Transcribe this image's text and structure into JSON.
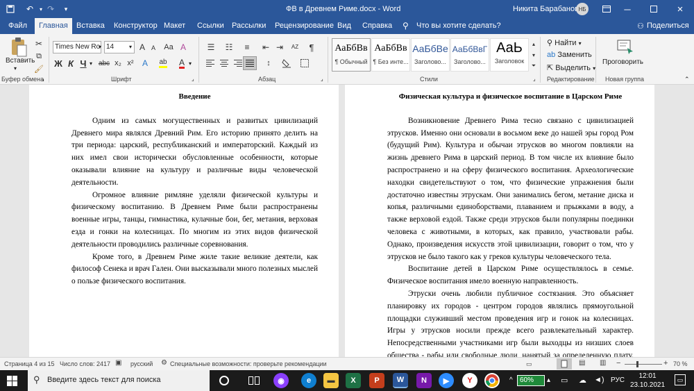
{
  "titlebar": {
    "doc_title": "ФВ в Древнем Риме.docx  -  Word",
    "user": "Никита Барабанов",
    "initials": "НБ"
  },
  "tabs": [
    "Файл",
    "Главная",
    "Вставка",
    "Конструктор",
    "Макет",
    "Ссылки",
    "Рассылки",
    "Рецензирование",
    "Вид",
    "Справка"
  ],
  "tell_me": "Что вы хотите сделать?",
  "share": "Поделиться",
  "ribbon": {
    "clipboard": {
      "paste": "Вставить",
      "label": "Буфер обмена"
    },
    "font": {
      "name": "Times New Ro",
      "size": "14",
      "label": "Шрифт",
      "bold": "Ж",
      "italic": "К",
      "underline": "Ч",
      "strike": "abc",
      "sub": "x₂",
      "sup": "x²",
      "grow": "A",
      "shrink": "A",
      "case": "Aa",
      "clear": "A",
      "highlight": "ab",
      "color": "A",
      "colors": {
        "highlight": "#ffff00",
        "font": "#e02020"
      }
    },
    "paragraph": {
      "label": "Абзац",
      "pilcrow": "¶",
      "sort": "AZ"
    },
    "styles": {
      "label": "Стили",
      "items": [
        {
          "preview": "АаБбВв",
          "name": "¶ Обычный"
        },
        {
          "preview": "АаБбВв",
          "name": "¶ Без инте..."
        },
        {
          "preview": "АаБбВе",
          "name": "Заголово..."
        },
        {
          "preview": "АаБбВвГ",
          "name": "Заголово..."
        },
        {
          "preview": "АаЬ",
          "name": "Заголовок"
        }
      ]
    },
    "editing": {
      "find": "Найти",
      "replace": "Заменить",
      "select": "Выделить",
      "label": "Редактирование"
    },
    "new_group": {
      "button": "Проговорить",
      "label": "Новая группа"
    }
  },
  "page1": {
    "heading": "Введение",
    "paragraphs": [
      "Одним из самых могущественных и развитых цивилизаций Древнего мира являлся Древний Рим. Его историю принято делить на три периода: царский, республиканский и императорский. Каждый из них имел свои историчeски обусловленные особенности, которые оказывали влияние на культуру и различные виды человеческой деятельности.",
      "Огромное влияние римляне уделяли физической культуры и физическому воспитанию. В Древнем Риме были распространены военные игры, танцы, гимнастика, кулачные бои, бег, метания, верховая езда и гонки на колесницах. По многим из этих видов физической деятельности проводились различные соревнования.",
      "Кроме того, в Древнем Риме жиле такие великие деятели, как философ Сенека и врач Гален. Они высказывали много полезных мыслей о пользе физического воспитания."
    ]
  },
  "page2": {
    "heading": "Физическая культура и физическое воспитание в Царском Риме",
    "paragraphs": [
      "Возникновение Древнего Рима тесно связано с цивилизацией этрусков. Именно они основали в восьмом веке до нашей эры город Ром (будущий Рим). Культура и обычаи этрусков во многом повлияли на жизнь древнего Рима в царский период. В том числе их влияние было распространено и на сферу физического воспитания. Археологические находки свидетельствуют о том, что физические упражнения были достаточно известны этрускам. Они занимались бегом, метание диска и копья, различными единоборствами, плаванием и прыжками в воду, а также верховой ездой. Также среди этрусков были популярны поединки человека с животными, в которых, как правило, участвовали рабы. Однако, произведения искусств этой цивилизации, говорит о том, что у этрусков не было такого как у греков культуры человеческого тела.",
      "Воспитание детей в Царском Риме осуществлялось в семье. Физическое воспитания имело военную направленность.",
      "Этруски очень любили публичное состязания. Это объясняет планировку их городов - центром городов являлись прямоугольной площадки служивший местом проведения игр и гонок на колесницах. Игры у этрусков носили прежде всего развлекательный характер. Непосредственными участниками игр были выходцы из низших слоев общества - рабы или свободные люди, нанятый за определенную плату. Особой популярностью пользовались троянские игры всадников. Смотреть игры могли все желающие: для царей и аристократов были"
    ]
  },
  "status": {
    "page": "Страница 4 из 15",
    "words": "Число слов: 2417",
    "lang": "русский",
    "access": "Специальные возможности: проверьте рекомендации",
    "zoom": "70 %",
    "zoom_value": 70
  },
  "taskbar": {
    "search": "Введите здесь текст для поиска",
    "battery": "60%",
    "lang": "РУС",
    "time": "12:01",
    "date": "23.10.2021"
  }
}
